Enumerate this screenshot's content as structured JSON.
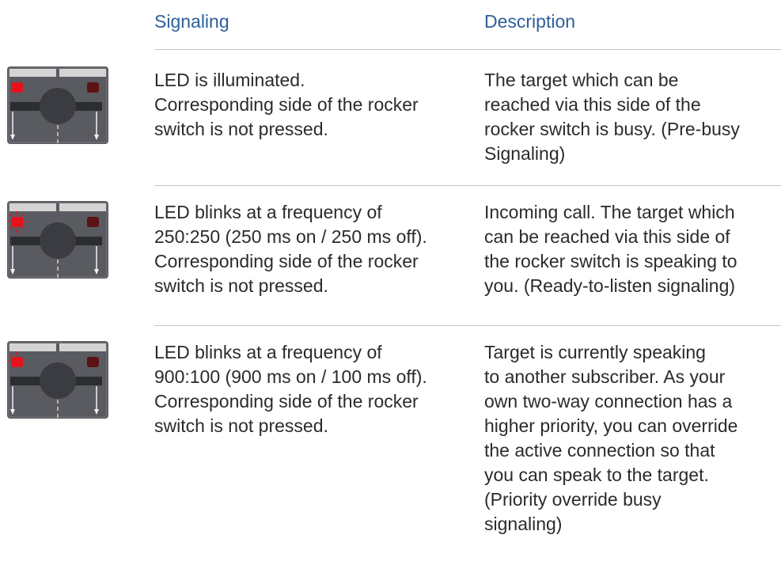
{
  "header": {
    "signaling_label": "Signaling",
    "description_label": "Description"
  },
  "colors": {
    "header_text": "#2f5f99",
    "body_text": "#2b2b2b",
    "rule": "#c6c6c6",
    "switch_body": "#5a5b60",
    "led_on": "#e5121b",
    "led_off": "#5a1212"
  },
  "rows": [
    {
      "icon": "rocker-switch-led-on-icon",
      "led_state": "on",
      "signaling_lines": [
        "LED is illuminated.",
        "Corresponding side of the rocker",
        "switch is not pressed."
      ],
      "description_lines": [
        "The target which can be",
        "reached via this side of the",
        "rocker switch is busy. (Pre-busy",
        "Signaling)"
      ]
    },
    {
      "icon": "rocker-switch-led-blinking-icon",
      "led_state": "blink",
      "signaling_lines": [
        "LED blinks at a frequency of",
        "250:250 (250 ms on / 250 ms off).",
        "Corresponding side of the rocker",
        "switch is not pressed."
      ],
      "description_lines": [
        "Incoming call. The target which",
        "can be reached via this side of",
        "the rocker switch is speaking to",
        "you. (Ready-to-listen signaling)"
      ]
    },
    {
      "icon": "rocker-switch-led-blinking-icon",
      "led_state": "blink",
      "signaling_lines": [
        "LED blinks at a frequency of",
        "900:100 (900 ms on / 100 ms off).",
        "Corresponding side of the rocker",
        "switch is not pressed."
      ],
      "description_lines": [
        "Target is currently speaking",
        "to another subscriber. As your",
        "own two-way connection has a",
        "higher priority, you can override",
        "the active connection so that",
        "you can speak to the target.",
        "(Priority override busy",
        "signaling)"
      ]
    }
  ]
}
